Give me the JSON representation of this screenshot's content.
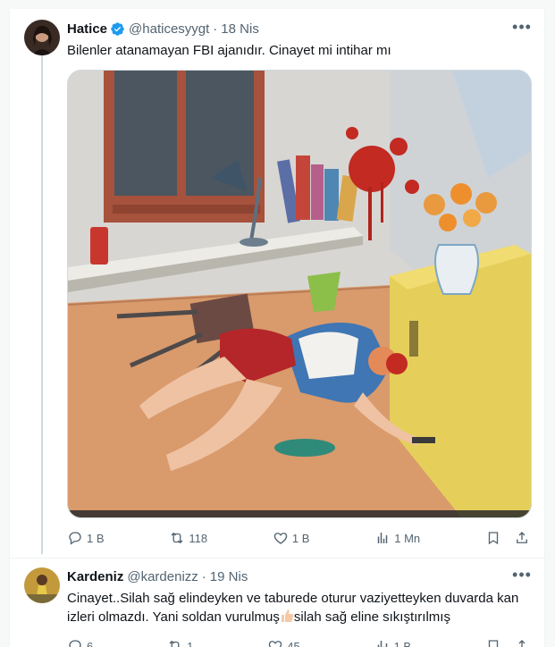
{
  "tweet1": {
    "author_name": "Hatice",
    "handle": "@haticesyygt",
    "separator": "·",
    "date": "18 Nis",
    "text": "Bilenler atanamayan FBI ajanıdır. Cinayet mi intihar mı",
    "verified": true,
    "media_icon": "illustration-crime-scene",
    "actions": {
      "replies": "1 B",
      "reposts": "118",
      "likes": "1 B",
      "views": "1 Mn"
    }
  },
  "tweet2": {
    "author_name": "Kardeniz",
    "handle": "@kardenizz",
    "separator": "·",
    "date": "19 Nis",
    "text_part1": "Cinayet..Silah sağ elindeyken ve taburede oturur vaziyetteyken duvarda kan izleri olmazdı. Yani soldan vurulmuş",
    "text_part2": "silah sağ eline sıkıştırılmış",
    "actions": {
      "replies": "6",
      "reposts": "1",
      "likes": "45",
      "views": "1 B"
    }
  },
  "colors": {
    "text_primary": "#0f1419",
    "text_secondary": "#536471",
    "verified_blue": "#1d9bf0",
    "border": "#cfd9de"
  }
}
